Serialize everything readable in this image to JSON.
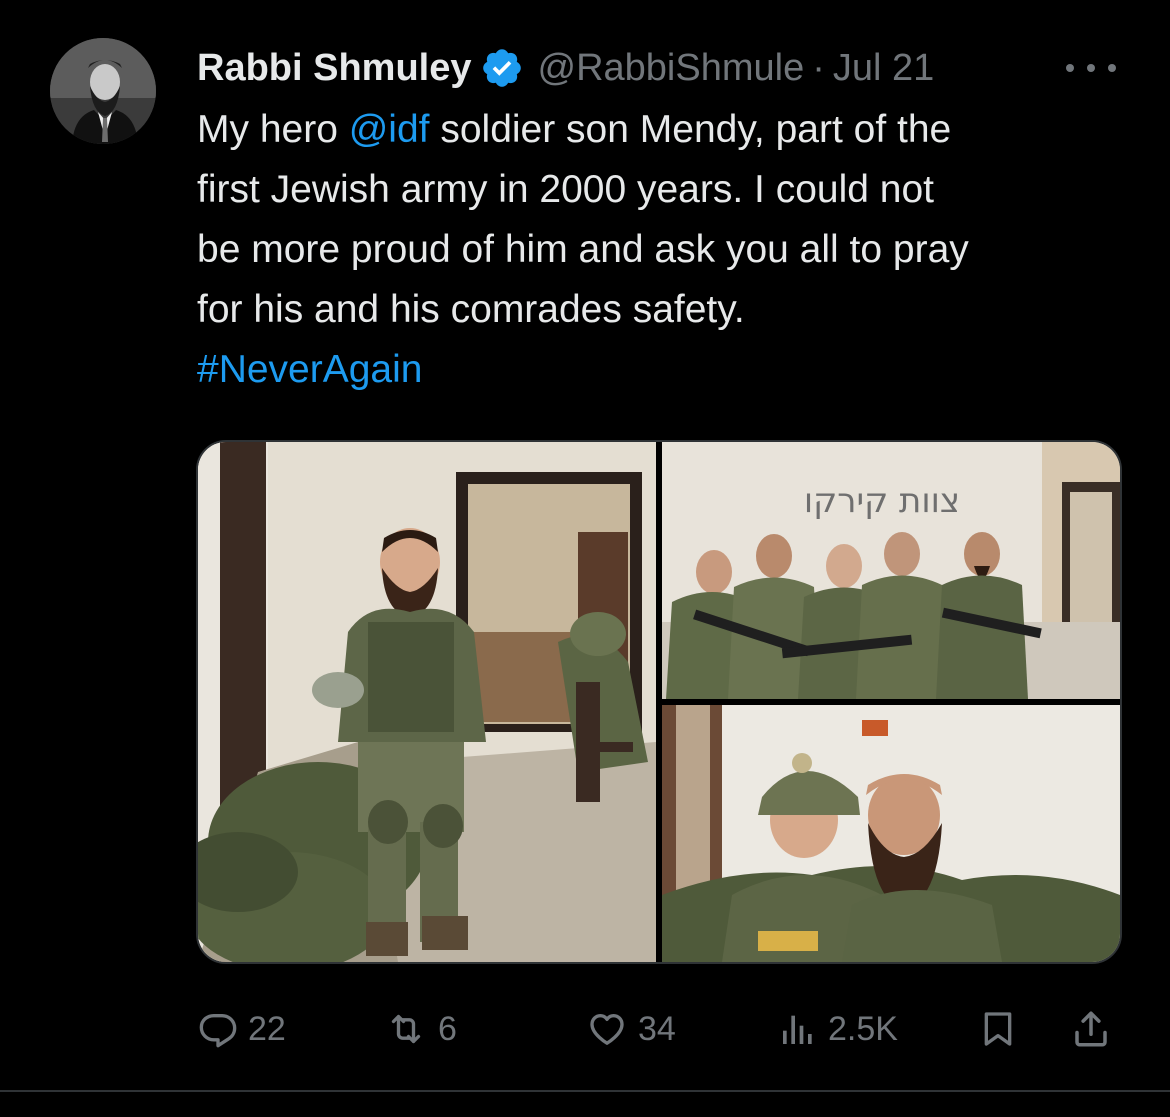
{
  "author": {
    "display_name": "Rabbi Shmuley",
    "handle": "@RabbiShmule",
    "separator": "·",
    "date": "Jul 21",
    "verified": true,
    "avatar_icon": "profile-photo"
  },
  "tweet": {
    "lines": [
      [
        {
          "text": "My hero ",
          "link": false
        },
        {
          "text": "@idf",
          "link": true
        },
        {
          "text": " soldier son Mendy, part of the",
          "link": false
        }
      ],
      [
        {
          "text": "first Jewish army in 2000 years. I could not",
          "link": false
        }
      ],
      [
        {
          "text": "be more proud of him and ask you all to pray",
          "link": false
        }
      ],
      [
        {
          "text": "for his and his comrades safety.",
          "link": false
        }
      ],
      [
        {
          "text": "#NeverAgain",
          "link": true
        }
      ]
    ]
  },
  "media": {
    "photos": [
      {
        "name": "photo-soldier-standing"
      },
      {
        "name": "photo-soldiers-group",
        "wall_text": "צוות קירקו"
      },
      {
        "name": "photo-two-soldiers"
      }
    ]
  },
  "actions": {
    "replies": {
      "icon": "reply-icon",
      "count": "22"
    },
    "reposts": {
      "icon": "repost-icon",
      "count": "6"
    },
    "likes": {
      "icon": "like-icon",
      "count": "34"
    },
    "views": {
      "icon": "views-icon",
      "count": "2.5K"
    },
    "bookmark": {
      "icon": "bookmark-icon"
    },
    "share": {
      "icon": "share-icon"
    }
  },
  "colors": {
    "background": "#000000",
    "text": "#e7e9ea",
    "secondary": "#71767b",
    "link": "#1d9bf0",
    "border": "#2f3336"
  }
}
